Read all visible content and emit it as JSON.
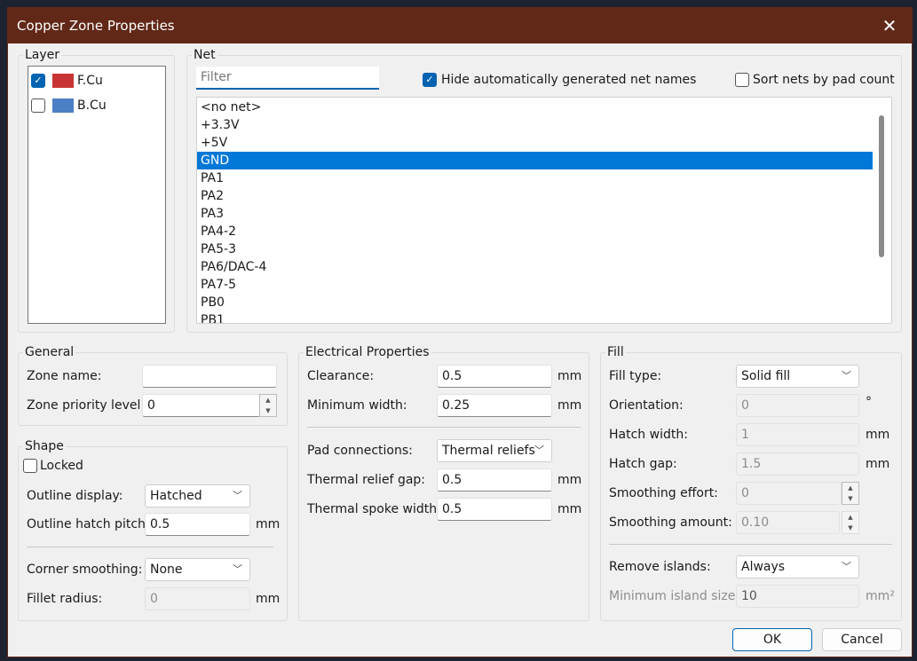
{
  "window": {
    "title": "Copper Zone Properties",
    "close_icon": "close-icon"
  },
  "layer": {
    "label": "Layer",
    "items": [
      {
        "name": "F.Cu",
        "checked": true,
        "color": "#c83434"
      },
      {
        "name": "B.Cu",
        "checked": false,
        "color": "#4d7fc4"
      }
    ]
  },
  "net": {
    "label": "Net",
    "filter_placeholder": "Filter",
    "filter_value": "",
    "hide_auto_label": "Hide automatically generated net names",
    "hide_auto_checked": true,
    "sort_label": "Sort nets by pad count",
    "sort_checked": false,
    "items": [
      "<no net>",
      "+3.3V",
      "+5V",
      "GND",
      "PA1",
      "PA2",
      "PA3",
      "PA4-2",
      "PA5-3",
      "PA6/DAC-4",
      "PA7-5",
      "PB0",
      "PB1"
    ],
    "selected": "GND"
  },
  "general": {
    "label": "General",
    "zone_name_label": "Zone name:",
    "zone_name": "",
    "priority_label": "Zone priority level:",
    "priority": "0"
  },
  "shape": {
    "label": "Shape",
    "locked_label": "Locked",
    "locked": false,
    "outline_display_label": "Outline display:",
    "outline_display": "Hatched",
    "hatch_pitch_label": "Outline hatch pitch:",
    "hatch_pitch": "0.5",
    "hatch_pitch_unit": "mm",
    "corner_label": "Corner smoothing:",
    "corner": "None",
    "fillet_label": "Fillet radius:",
    "fillet": "0",
    "fillet_unit": "mm"
  },
  "electrical": {
    "label": "Electrical Properties",
    "clearance_label": "Clearance:",
    "clearance": "0.5",
    "clearance_unit": "mm",
    "min_width_label": "Minimum width:",
    "min_width": "0.25",
    "min_width_unit": "mm",
    "pad_label": "Pad connections:",
    "pad": "Thermal reliefs",
    "relief_gap_label": "Thermal relief gap:",
    "relief_gap": "0.5",
    "relief_gap_unit": "mm",
    "spoke_label": "Thermal spoke width:",
    "spoke": "0.5",
    "spoke_unit": "mm"
  },
  "fill": {
    "label": "Fill",
    "type_label": "Fill type:",
    "type": "Solid fill",
    "orientation_label": "Orientation:",
    "orientation": "0",
    "orientation_unit": "°",
    "hatch_width_label": "Hatch width:",
    "hatch_width": "1",
    "hatch_width_unit": "mm",
    "hatch_gap_label": "Hatch gap:",
    "hatch_gap": "1.5",
    "hatch_gap_unit": "mm",
    "smooth_effort_label": "Smoothing effort:",
    "smooth_effort": "0",
    "smooth_amount_label": "Smoothing amount:",
    "smooth_amount": "0.10",
    "islands_label": "Remove islands:",
    "islands": "Always",
    "min_island_label": "Minimum island size:",
    "min_island": "10",
    "min_island_unit": "mm²"
  },
  "buttons": {
    "ok": "OK",
    "cancel": "Cancel"
  }
}
